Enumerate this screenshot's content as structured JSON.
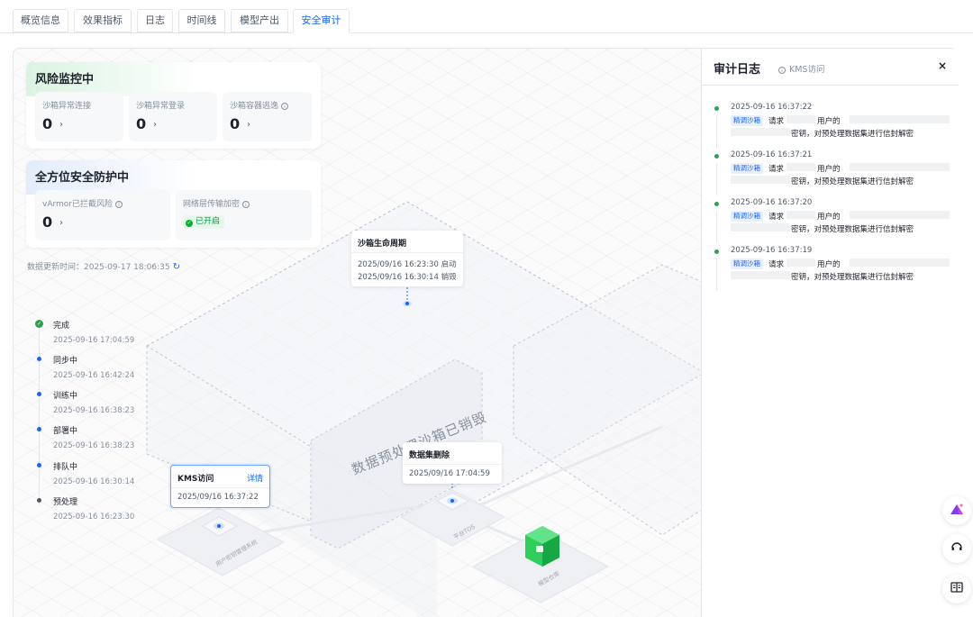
{
  "tabs": [
    {
      "label": "概览信息"
    },
    {
      "label": "效果指标"
    },
    {
      "label": "日志"
    },
    {
      "label": "时间线"
    },
    {
      "label": "模型产出"
    },
    {
      "label": "安全审计",
      "active": true
    }
  ],
  "risk_card": {
    "title": "风险监控中",
    "metrics": [
      {
        "label": "沙箱异常连接",
        "value": "0",
        "has_info": false
      },
      {
        "label": "沙箱异常登录",
        "value": "0",
        "has_info": false
      },
      {
        "label": "沙箱容器逃逸",
        "value": "0",
        "has_info": true
      }
    ]
  },
  "protect_card": {
    "title": "全方位安全防护中",
    "vArmor": {
      "label": "vArmor已拦截风险",
      "value": "0"
    },
    "encryption": {
      "label": "网络层传输加密",
      "status": "已开启"
    }
  },
  "update_time": "数据更新时间：2025-09-17 18:06:35",
  "timeline": [
    {
      "label": "完成",
      "time": "2025-09-16 17:04:59",
      "status": "done",
      "color": "#2fa04f"
    },
    {
      "label": "同步中",
      "time": "2025-09-16 16:42:24",
      "status": "active",
      "color": "#1664ff"
    },
    {
      "label": "训练中",
      "time": "2025-09-16 16:38:23",
      "status": "active",
      "color": "#1664ff"
    },
    {
      "label": "部署中",
      "time": "2025-09-16 16:38:23",
      "status": "active",
      "color": "#1664ff"
    },
    {
      "label": "排队中",
      "time": "2025-09-16 16:30:14",
      "status": "active",
      "color": "#1664ff"
    },
    {
      "label": "预处理",
      "time": "2025-09-16 16:23:30",
      "status": "pending",
      "color": "#4e5969"
    }
  ],
  "sandbox_lifecycle": {
    "title": "沙箱生命周期",
    "start": "2025/09/16 16:23:30 启动",
    "destroy": "2025/09/16 16:30:14 销毁"
  },
  "region_label": "数据预处理沙箱已销毁",
  "kms_popup": {
    "title": "KMS访问",
    "link": "详情",
    "time": "2025/09/16 16:37:22"
  },
  "dataset_delete_popup": {
    "title": "数据集删除",
    "time": "2025/09/16 17:04:59"
  },
  "node_labels": {
    "user_key": "用户密钥管理系统",
    "platform_tos": "平台TOS",
    "model_warehouse": "模型仓库"
  },
  "audit_panel": {
    "title": "审计日志",
    "subtitle": "KMS访问",
    "close": "×",
    "entries": [
      {
        "time": "2025-09-16 16:37:22",
        "tag": "精调沙箱",
        "request": "请求",
        "user_of": "用户的",
        "action": "密钥，对预处理数据集进行信封解密"
      },
      {
        "time": "2025-09-16 16:37:21",
        "tag": "精调沙箱",
        "request": "请求",
        "user_of": "用户的",
        "action": "密钥，对预处理数据集进行信封解密"
      },
      {
        "time": "2025-09-16 16:37:20",
        "tag": "精调沙箱",
        "request": "请求",
        "user_of": "用户的",
        "action": "密钥，对预处理数据集进行信封解密"
      },
      {
        "time": "2025-09-16 16:37:19",
        "tag": "精调沙箱",
        "request": "请求",
        "user_of": "用户的",
        "action": "密钥，对预处理数据集进行信封解密"
      }
    ]
  },
  "colors": {
    "primary": "#1664ff",
    "success": "#2fa04f",
    "text": "#1d2129",
    "muted": "#86909c"
  }
}
